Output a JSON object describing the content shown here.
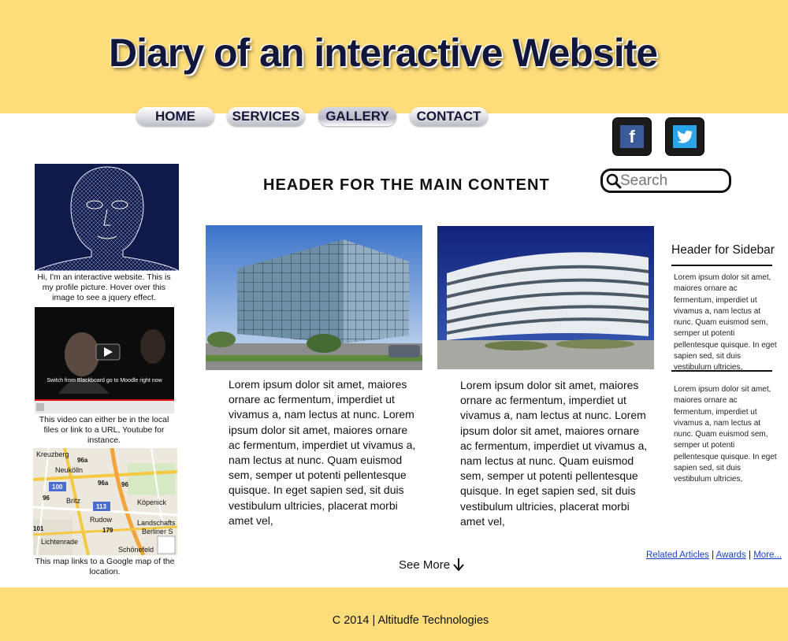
{
  "site": {
    "title": "Diary of an interactive Website",
    "header_bg": "#fddd7a",
    "title_color": "#13163b"
  },
  "nav": {
    "items": [
      {
        "label": "HOME"
      },
      {
        "label": "SERVICES"
      },
      {
        "label": "GALLERY",
        "active": true
      },
      {
        "label": "CONTACT"
      }
    ]
  },
  "social": {
    "facebook": {
      "icon": "facebook-icon",
      "glyph": "f"
    },
    "twitter": {
      "icon": "twitter-bird-icon"
    }
  },
  "search": {
    "placeholder": "Search",
    "value": ""
  },
  "main": {
    "header": "HEADER FOR THE MAIN CONTENT",
    "columns": [
      {
        "image": "glass-office-building-photo",
        "text": "Lorem ipsum dolor sit amet, maiores ornare ac fermentum, imperdiet ut vivamus a, nam lectus at nunc. Lorem ipsum dolor sit amet, maiores ornare ac fermentum, imperdiet ut vivamus a, nam lectus at nunc. Quam euismod sem, semper ut potenti pellentesque quisque. In eget sapien sed, sit duis vestibulum ultricies, placerat morbi amet vel,"
      },
      {
        "image": "curved-office-building-photo",
        "text": "Lorem ipsum dolor sit amet, maiores ornare ac fermentum, imperdiet ut vivamus a, nam lectus at nunc. Lorem ipsum dolor sit amet, maiores ornare ac fermentum, imperdiet ut vivamus a, nam lectus at nunc. Quam euismod sem, semper ut potenti pellentesque quisque. In eget sapien sed, sit duis vestibulum ultricies, placerat morbi amet vel,"
      }
    ],
    "see_more": "See More"
  },
  "left": {
    "profile_caption": "Hi, I'm an interactive website. This is my profile picture. Hover over this image to see a jquery effect.",
    "video_caption": "This video can either be in the local files or link to a URL, Youtube for instance.",
    "video_overlay_text": "Switch from Blackboard go to Moodle right now",
    "map_caption": "This map links to a Google map of the location.",
    "map_labels": [
      "Kreuzberg",
      "Neukölln",
      "Britz",
      "Rudow",
      "Köpenick",
      "Landschafts",
      "Berliner S",
      "Lichtenrade",
      "Schönefeld",
      "96a",
      "100",
      "96",
      "113",
      "179",
      "101",
      "96a",
      "96"
    ]
  },
  "sidebar": {
    "header": "Header for Sidebar",
    "paragraphs": [
      "Lorem ipsum dolor sit amet, maiores ornare ac fermentum, imperdiet ut vivamus a, nam lectus at nunc. Quam euismod sem, semper ut potenti pellentesque quisque. In eget sapien sed, sit duis vestibulum ultricies,",
      "Lorem ipsum dolor sit amet, maiores ornare ac fermentum, imperdiet ut vivamus a, nam lectus at nunc. Quam euismod sem, semper ut potenti pellentesque quisque. In eget sapien sed, sit duis vestibulum ultricies,"
    ],
    "links": {
      "related": "Related Articles",
      "awards": "Awards",
      "more": "More...",
      "separator": "|"
    },
    "link_color": "#1a43c9"
  },
  "footer": {
    "text": "C 2014 | Altitudfe Technologies"
  }
}
